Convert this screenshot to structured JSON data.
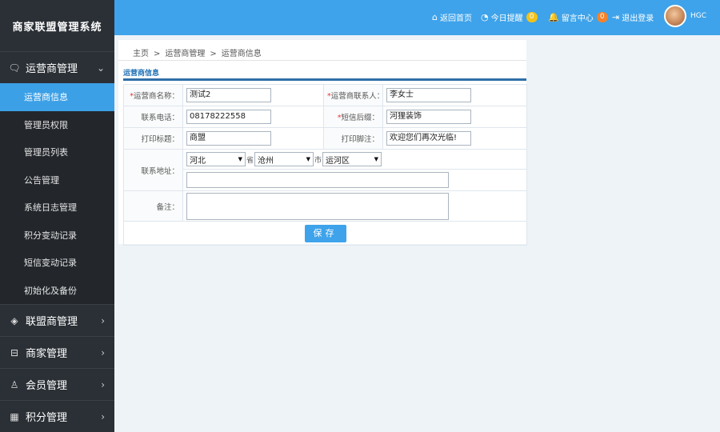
{
  "app": {
    "title": "商家联盟管理系统"
  },
  "sidebar": {
    "groups": [
      {
        "icon": "message-icon",
        "glyph": "🗨",
        "label": "运营商管理",
        "expanded_chev": "⌄"
      },
      {
        "icon": "diamond-icon",
        "glyph": "◈",
        "label": "联盟商管理",
        "chev": "›"
      },
      {
        "icon": "store-icon",
        "glyph": "⊟",
        "label": "商家管理",
        "chev": "›"
      },
      {
        "icon": "user-icon",
        "glyph": "♙",
        "label": "会员管理",
        "chev": "›"
      },
      {
        "icon": "calendar-icon",
        "glyph": "▦",
        "label": "积分管理",
        "chev": "›"
      }
    ],
    "sub_items": [
      {
        "label": "运营商信息",
        "active": true
      },
      {
        "label": "管理员权限"
      },
      {
        "label": "管理员列表"
      },
      {
        "label": "公告管理"
      },
      {
        "label": "系统日志管理"
      },
      {
        "label": "积分变动记录"
      },
      {
        "label": "短信变动记录"
      },
      {
        "label": "初始化及备份"
      }
    ]
  },
  "topbar": {
    "home": {
      "icon": "home-icon",
      "glyph": "⌂",
      "label": "返回首页"
    },
    "reminder": {
      "icon": "clock-icon",
      "glyph": "◔",
      "label": "今日提醒",
      "count": "0"
    },
    "messages": {
      "icon": "bell-icon",
      "glyph": "🔔",
      "label": "留言中心",
      "count": "0"
    },
    "logout": {
      "icon": "logout-icon",
      "glyph": "⇥",
      "label": "退出登录"
    },
    "username": "HGC",
    "colors": {
      "bar": "#3ea3ea",
      "badge_yellow": "#f2c21a",
      "badge_orange": "#f5822a"
    }
  },
  "breadcrumb": {
    "items": [
      "主页",
      "运营商管理",
      "运营商信息"
    ],
    "separator": ">"
  },
  "form": {
    "section_title": "运营商信息",
    "name_label": "运营商名称：",
    "name_value": "测试2",
    "contact_label": "运营商联系人：",
    "contact_value": "李女士",
    "phone_label": "联系电话：",
    "phone_value": "08178222558",
    "sms_suffix_label": "短信后缀：",
    "sms_suffix_value": "河狸装饰",
    "print_title_label": "打印标题：",
    "print_title_value": "商盟",
    "print_footer_label": "打印脚注：",
    "print_footer_value": "欢迎您们再次光临!",
    "address_label": "联系地址：",
    "province_value": "河北",
    "province_unit": "省",
    "city_value": "沧州",
    "city_unit": "市",
    "district_value": "运河区",
    "address_detail_value": "",
    "remark_label": "备注：",
    "remark_value": "",
    "required_mark": "*",
    "save_label": "保存"
  }
}
